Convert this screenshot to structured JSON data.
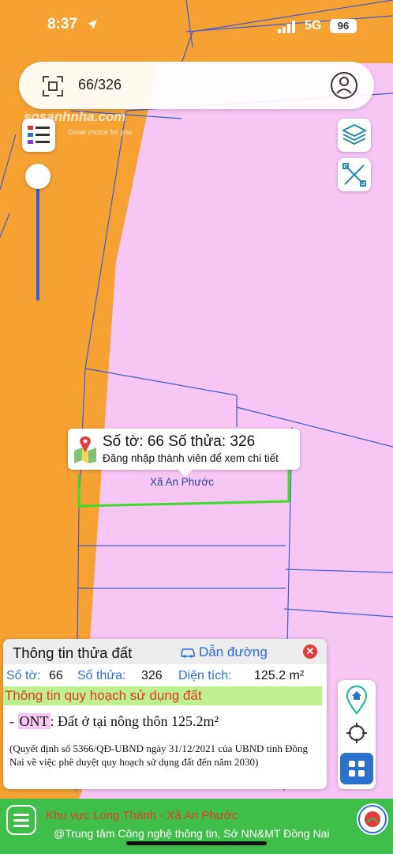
{
  "status_bar": {
    "time": "8:37",
    "network": "5G",
    "battery": "96"
  },
  "search": {
    "value": "66/326"
  },
  "watermark": {
    "brand": "sosanhnha.com",
    "tagline": "Great choice for you"
  },
  "popup": {
    "title": "Số tờ: 66 Số thửa: 326",
    "subtitle": "Đăng nhập thành viên để xem chi tiết"
  },
  "map_label": "Xã An Phước",
  "info_panel": {
    "title": "Thông tin thửa đất",
    "directions_label": "Dẫn đường",
    "sheet_label": "Số tờ:",
    "sheet_value": "66",
    "parcel_label": "Số thửa:",
    "parcel_value": "326",
    "area_label": "Diện tích:",
    "area_value": "125.2 m²",
    "section_title": "Thông tin quy hoạch sử dụng đất",
    "ont_prefix": "- ",
    "ont_code": "ONT",
    "ont_desc": ": Đất ở tại nông thôn 125.2m²",
    "note": "(Quyết định số 5366/QĐ-UBND ngày 31/12/2021 của UBND tỉnh Đồng Nai về việc phê duyệt quy hoạch sử dụng đất đến năm 2030)"
  },
  "footer": {
    "line1": "Khu vực Long Thành - Xã An Phước",
    "line2": "@Trung tâm Công nghệ thông tin, Sở NN&MT Đồng Nai"
  },
  "colors": {
    "orange_zone": "#f5a233",
    "pink_zone": "#f8c6f5",
    "parcel_lines": "#3f5bd6",
    "selected_parcel": "#3ddc2a",
    "footer_green": "#3fbe4c",
    "accent_blue": "#2a6fd6"
  }
}
